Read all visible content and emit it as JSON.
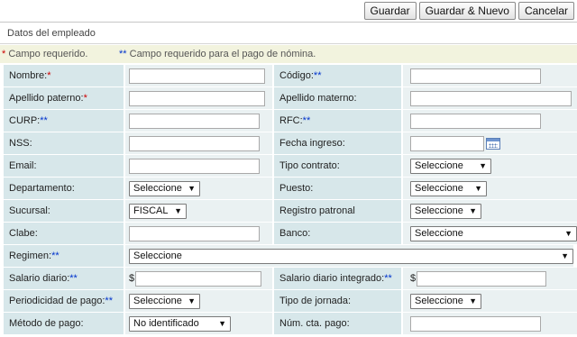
{
  "toolbar": {
    "save_label": "Guardar",
    "save_new_label": "Guardar & Nuevo",
    "cancel_label": "Cancelar"
  },
  "section": {
    "title": "Datos del empleado"
  },
  "notice": {
    "required_mark": "*",
    "required_text": " Campo requerido.",
    "payroll_mark": "**",
    "payroll_text": " Campo requerido para el pago de nómina."
  },
  "fields": {
    "nombre": {
      "label": "Nombre:",
      "mark": "*",
      "value": ""
    },
    "codigo": {
      "label": "Código:",
      "mark": "**",
      "value": ""
    },
    "apellido_paterno": {
      "label": "Apellido paterno:",
      "mark": "*",
      "value": ""
    },
    "apellido_materno": {
      "label": "Apellido materno:",
      "value": ""
    },
    "curp": {
      "label": "CURP:",
      "mark": "**",
      "value": ""
    },
    "rfc": {
      "label": "RFC:",
      "mark": "**",
      "value": ""
    },
    "nss": {
      "label": "NSS:",
      "value": ""
    },
    "fecha_ingreso": {
      "label": "Fecha ingreso:",
      "value": ""
    },
    "email": {
      "label": "Email:",
      "value": ""
    },
    "tipo_contrato": {
      "label": "Tipo contrato:",
      "selected": "Seleccione"
    },
    "departamento": {
      "label": "Departamento:",
      "selected": "Seleccione"
    },
    "puesto": {
      "label": "Puesto:",
      "selected": "Seleccione"
    },
    "sucursal": {
      "label": "Sucursal:",
      "selected": "FISCAL"
    },
    "registro_patronal": {
      "label": "Registro patronal",
      "selected": "Seleccione"
    },
    "clabe": {
      "label": "Clabe:",
      "value": ""
    },
    "banco": {
      "label": "Banco:",
      "selected": "Seleccione"
    },
    "regimen": {
      "label": "Regimen:",
      "mark": "**",
      "selected": "Seleccione"
    },
    "salario_diario": {
      "label": "Salario diario:",
      "mark": "**",
      "currency": "$",
      "value": ""
    },
    "salario_diario_integrado": {
      "label": "Salario diario integrado:",
      "mark": "**",
      "currency": "$",
      "value": ""
    },
    "periodicidad_pago": {
      "label": "Periodicidad de pago:",
      "mark": "**",
      "selected": "Seleccione"
    },
    "tipo_jornada": {
      "label": "Tipo de jornada:",
      "selected": "Seleccione"
    },
    "metodo_pago": {
      "label": "Método de pago:",
      "selected": "No identificado"
    },
    "num_cta_pago": {
      "label": "Núm. cta. pago:",
      "value": ""
    }
  },
  "icons": {
    "calendar": "calendar-icon",
    "dropdown": "chevron-down-icon"
  },
  "colors": {
    "label_bg": "#d7e7ea",
    "value_bg": "#eaf1f2",
    "notice_bg": "#f2f3de",
    "required_color": "#cc0000",
    "payroll_color": "#0033cc"
  }
}
